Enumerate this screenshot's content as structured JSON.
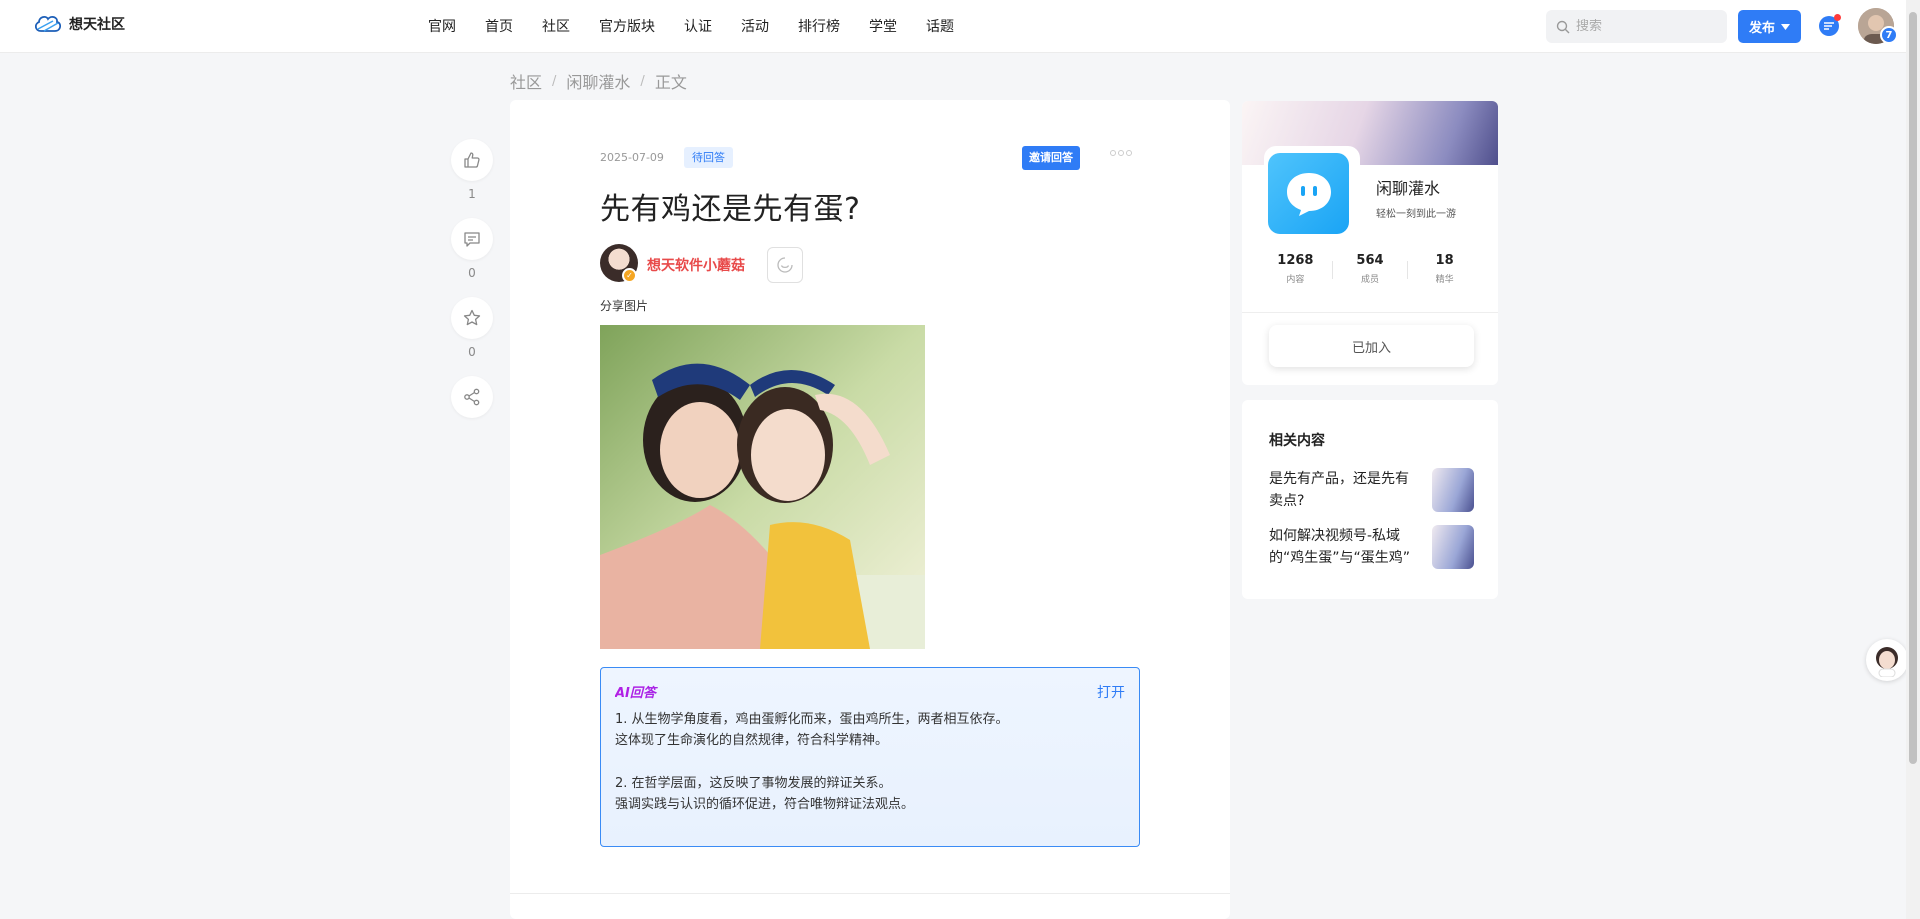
{
  "header": {
    "logo_text": "想天社区",
    "nav": [
      "官网",
      "首页",
      "社区",
      "官方版块",
      "认证",
      "活动",
      "排行榜",
      "学堂",
      "话题"
    ],
    "search_placeholder": "搜索",
    "publish_label": "发布",
    "notification_count": "7"
  },
  "breadcrumb": [
    "社区",
    "闲聊灌水",
    "正文"
  ],
  "actions": {
    "like_count": "1",
    "comment_count": "0",
    "favorite_count": "0"
  },
  "post": {
    "date": "2025-07-09",
    "status": "待回答",
    "invite_label": "邀请回答",
    "title": "先有鸡还是先有蛋?",
    "author": "想天软件小蘑菇",
    "body_text": "分享图片"
  },
  "ai_answer": {
    "title": "AI回答",
    "open_label": "打开",
    "lines": [
      "1. 从生物学角度看，鸡由蛋孵化而来，蛋由鸡所生，两者相互依存。",
      "这体现了生命演化的自然规律，符合科学精神。",
      "2. 在哲学层面，这反映了事物发展的辩证关系。",
      "强调实践与认识的循环促进，符合唯物辩证法观点。"
    ]
  },
  "circle": {
    "name": "闲聊灌水",
    "desc": "轻松一刻到此一游",
    "stats": [
      {
        "value": "1268",
        "label": "内容"
      },
      {
        "value": "564",
        "label": "成员"
      },
      {
        "value": "18",
        "label": "精华"
      }
    ],
    "joined_label": "已加入"
  },
  "related": {
    "title": "相关内容",
    "items": [
      {
        "text": "是先有产品，还是先有卖点?"
      },
      {
        "text": "如何解决视频号-私域的“鸡生蛋”与“蛋生鸡”"
      }
    ]
  },
  "colors": {
    "accent": "#2f7cf6",
    "author": "#e84a4a",
    "ai_border": "#3a8bf5"
  }
}
